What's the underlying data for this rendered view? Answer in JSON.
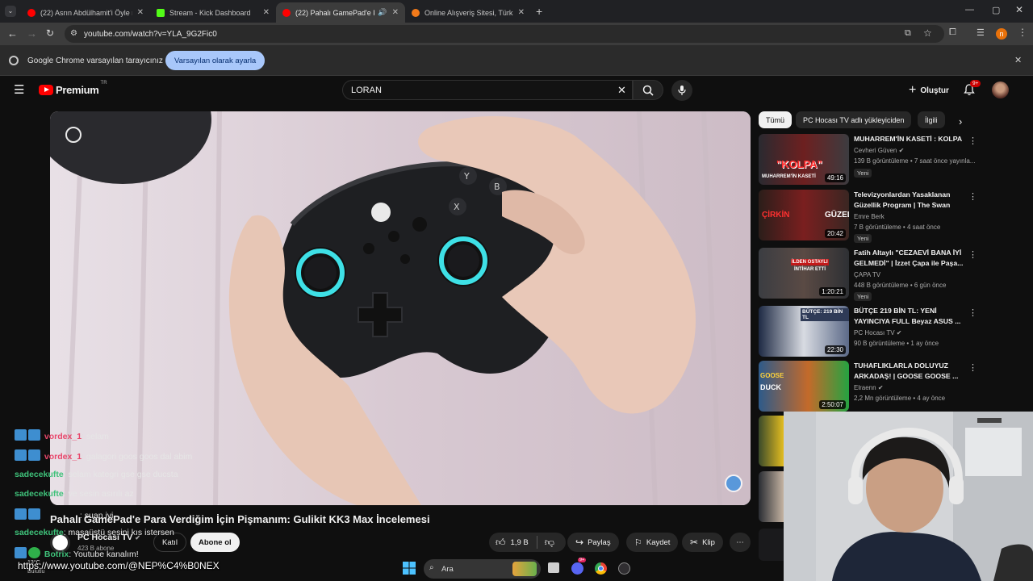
{
  "browser": {
    "tabs": [
      {
        "title": "(22) Asrın Abdülhamit'i Öyle m",
        "active": false
      },
      {
        "title": "Stream - Kick Dashboard",
        "active": false
      },
      {
        "title": "(22) Pahalı GamePad'e Para",
        "active": true
      },
      {
        "title": "Online Alışveriş Sitesi, Türkiye'n",
        "active": false
      }
    ],
    "url": "youtube.com/watch?v=YLA_9G2Fic0",
    "profile_initial": "n"
  },
  "infobar": {
    "message": "Google Chrome varsayılan tarayıcınız değil",
    "button": "Varsayılan olarak ayarla"
  },
  "youtube": {
    "logo_text": "Premium",
    "region": "TR",
    "search_value": "LORAN",
    "create_label": "Oluştur",
    "notif_count": "9+"
  },
  "chips": [
    "Tümü",
    "PC Hocası TV adlı yükleyiciden",
    "İlgili"
  ],
  "recommendations": [
    {
      "title": "MUHARREM'İN KASETİ : KOLPA",
      "channel": "Cevheri Güven",
      "verified": true,
      "views": "139 B görüntüleme",
      "age": "7 saat önce yayınla...",
      "duration": "49:16",
      "badge": "Yeni",
      "thumb_text": "\"KOLPA\"",
      "thumb_sub": "MUHARREM'İN KASETİ"
    },
    {
      "title": "Televizyonlardan Yasaklanan Güzellik Program | The Swan",
      "channel": "Emre Berk",
      "verified": false,
      "views": "7 B görüntüleme",
      "age": "4 saat önce",
      "duration": "20:42",
      "badge": "Yeni",
      "thumb_text": "ÇİRKİN",
      "thumb_sub": "GÜZEL"
    },
    {
      "title": "Fatih Altaylı \"CEZAEVİ BANA İYİ GELMEDİ\" | İzzet Çapa ile Paşa...",
      "channel": "ÇAPA TV",
      "verified": false,
      "views": "448 B görüntüleme",
      "age": "6 gün önce",
      "duration": "1:20:21",
      "badge": "Yeni",
      "thumb_text": "İLDEN OSTAYLI",
      "thumb_sub": "İNTİHAR ETTİ"
    },
    {
      "title": "BÜTÇE 219 BİN TL: YENİ YAYINCIYA FULL Beyaz ASUS ...",
      "channel": "PC Hocası TV",
      "verified": true,
      "views": "90 B görüntüleme",
      "age": "1 ay önce",
      "duration": "22:30",
      "badge": "",
      "thumb_text": "BÜTÇE: 219 BİN TL",
      "thumb_sub": ""
    },
    {
      "title": "TUHAFLIKLARLA DOLUYUZ ARKADAŞ! | GOOSE GOOSE ...",
      "channel": "Elraenn",
      "verified": true,
      "views": "2,2 Mn görüntüleme",
      "age": "4 ay önce",
      "duration": "2:50:07",
      "badge": "",
      "thumb_text": "GOOSE",
      "thumb_sub": "DUCK"
    }
  ],
  "video": {
    "title": "Pahalı GamePad'e Para Verdiğim İçin Pişmanım: Gulikit KK3 Max İncelemesi",
    "channel": "PC Hocası TV",
    "subscribers": "423 B abone",
    "join_label": "Katıl",
    "subscribe_label": "Abone ol",
    "likes": "1,9 B",
    "share_label": "Paylaş",
    "save_label": "Kaydet",
    "clip_label": "Klip"
  },
  "chat": [
    {
      "user": "vordex_1",
      "sep": ":",
      "msg": "selam",
      "color": "#e8476b",
      "icons": true
    },
    {
      "user": "vordex_1",
      "sep": ":",
      "msg": "galagori goos goos dal abim",
      "color": "#e8476b",
      "icons": true
    },
    {
      "user": "sadecekufte",
      "sep": ":",
      "msg": "selam kategri gse gse ducsta",
      "color": "#3fc27a",
      "icons": false
    },
    {
      "user": "sadecekufte",
      "sep": ":",
      "msg": "ve sesin asırılı az",
      "color": "#3fc27a",
      "icons": false
    },
    {
      "user": "",
      "sep": ":",
      "msg": "suan iyi",
      "color": "#e8476b",
      "icons": true
    },
    {
      "user": "sadecekufte",
      "sep": ":",
      "msg": "masaüstü sesini kıs istersen",
      "color": "#3fc27a",
      "icons": false
    },
    {
      "user": "Botrix",
      "sep": ":",
      "msg": "Youtube kanalım!",
      "color": "#3fc27a",
      "icons": true
    }
  ],
  "overlay_url": "https://www.youtube.com/@NEP%C4%B0NEX",
  "taskbar": {
    "search_label": "Ara",
    "weather_temp": "13°C",
    "weather_desc": "Bulutlu",
    "notif_badge": "9+"
  },
  "colors": {
    "youtube_red": "#ff0000",
    "chip_active": "#f1f1f1",
    "accent_blue": "#a8c7fa",
    "ring_cyan": "#3ee0e6"
  }
}
